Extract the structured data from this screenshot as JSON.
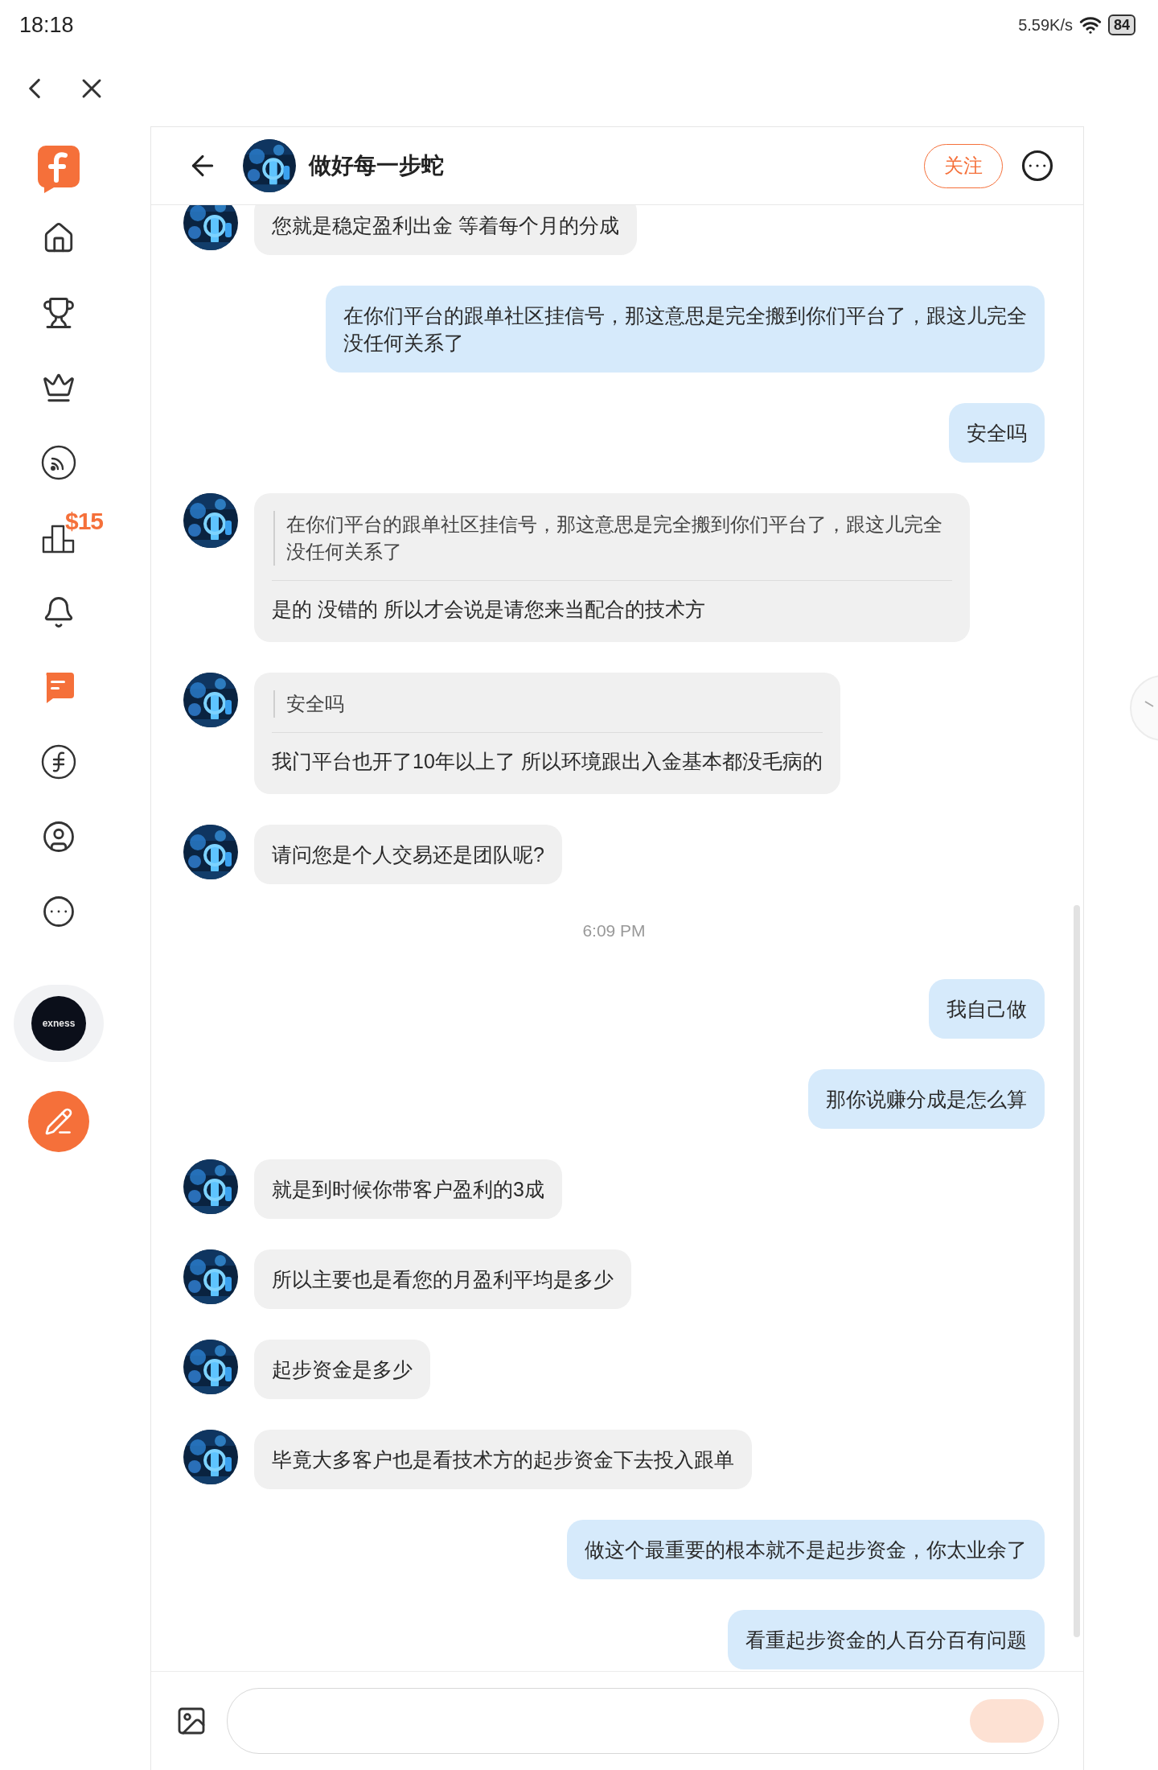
{
  "status_bar": {
    "time": "18:18",
    "net_speed": "5.59K/s",
    "battery": "84"
  },
  "sidebar": {
    "nav": [
      {
        "kind": "home",
        "selected": false
      },
      {
        "kind": "trophy",
        "selected": false
      },
      {
        "kind": "crown",
        "selected": false
      },
      {
        "kind": "feed",
        "selected": false
      },
      {
        "kind": "ranking",
        "selected": false,
        "badge": "$15"
      },
      {
        "kind": "bell",
        "selected": false
      },
      {
        "kind": "messages",
        "selected": true
      },
      {
        "kind": "coin",
        "selected": false
      },
      {
        "kind": "profile",
        "selected": false
      },
      {
        "kind": "more",
        "selected": false
      }
    ],
    "account_logo": "exness"
  },
  "chat": {
    "title": "做好每一步蛇",
    "follow_button": "关注",
    "messages": [
      {
        "kind": "text",
        "mine": false,
        "text": "您就是稳定盈利出金 等着每个月的分成"
      },
      {
        "kind": "text",
        "mine": true,
        "text": "在你们平台的跟单社区挂信号，那这意思是完全搬到你们平台了，跟这儿完全没任何关系了"
      },
      {
        "kind": "text",
        "mine": true,
        "text": "安全吗"
      },
      {
        "kind": "quote",
        "mine": false,
        "quote": "在你们平台的跟单社区挂信号，那这意思是完全搬到你们平台了，跟这儿完全没任何关系了",
        "text": "是的 没错的 所以才会说是请您来当配合的技术方"
      },
      {
        "kind": "quote",
        "mine": false,
        "quote": "安全吗",
        "text": "我门平台也开了10年以上了 所以环境跟出入金基本都没毛病的"
      },
      {
        "kind": "text",
        "mine": false,
        "text": "请问您是个人交易还是团队呢?"
      },
      {
        "kind": "time",
        "text": "6:09 PM"
      },
      {
        "kind": "text",
        "mine": true,
        "text": "我自己做"
      },
      {
        "kind": "text",
        "mine": true,
        "text": "那你说赚分成是怎么算"
      },
      {
        "kind": "text",
        "mine": false,
        "text": "就是到时候你带客户盈利的3成"
      },
      {
        "kind": "text",
        "mine": false,
        "text": "所以主要也是看您的月盈利平均是多少"
      },
      {
        "kind": "text",
        "mine": false,
        "text": "起步资金是多少"
      },
      {
        "kind": "text",
        "mine": false,
        "text": "毕竟大多客户也是看技术方的起步资金下去投入跟单"
      },
      {
        "kind": "text",
        "mine": true,
        "text": "做这个最重要的根本就不是起步资金，你太业余了"
      },
      {
        "kind": "text",
        "mine": true,
        "text": "看重起步资金的人百分百有问题"
      }
    ]
  }
}
